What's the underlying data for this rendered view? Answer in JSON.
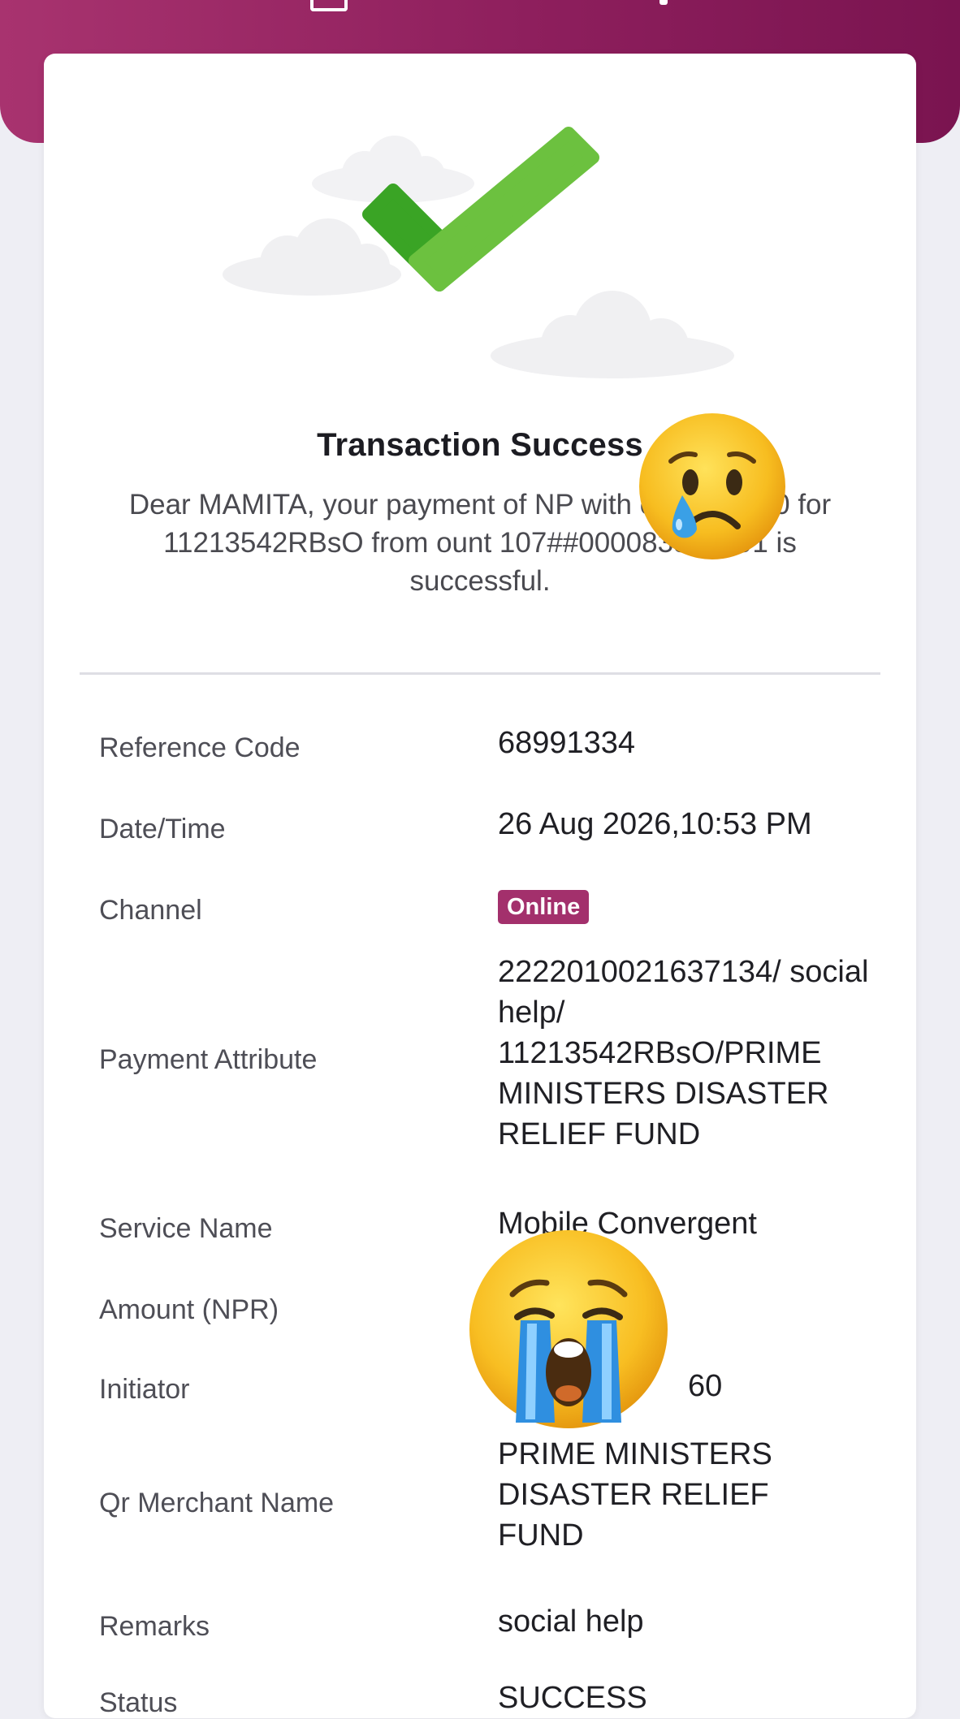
{
  "header": {},
  "result": {
    "title": "Transaction Success",
    "message": "Dear MAMITA, your payment of NP  with charge 0.00 for 11213542RBsO from  ount 107##000083318791 is successful."
  },
  "details": {
    "reference_code": {
      "label": "Reference Code",
      "value": "68991334"
    },
    "date_time": {
      "label": "Date/Time",
      "value": "26 Aug 2026,10:53 PM"
    },
    "channel": {
      "label": "Channel",
      "value": "Online"
    },
    "payment_attribute": {
      "label": "Payment Attribute",
      "value": "2222010021637134/ social help/ 11213542RBsO/PRIME MINISTERS DISASTER RELIEF FUND"
    },
    "service_name": {
      "label": "Service Name",
      "value": "Mobile Convergent"
    },
    "amount": {
      "label": "Amount (NPR)",
      "value": ""
    },
    "initiator": {
      "label": "Initiator",
      "value": "60"
    },
    "qr_merchant_name": {
      "label": "Qr Merchant Name",
      "value": "PRIME MINISTERS DISASTER RELIEF FUND"
    },
    "remarks": {
      "label": "Remarks",
      "value": "social help"
    },
    "status": {
      "label": "Status",
      "value": "SUCCESS"
    }
  },
  "colors": {
    "brand": "#8e1f5d",
    "check_dark": "#3aa425",
    "check_light": "#6cc13f",
    "badge": "#a3306c"
  },
  "icons": [
    "receipt-icon",
    "checkmark-icon",
    "crying-face-emoji",
    "loudly-crying-face-emoji"
  ]
}
